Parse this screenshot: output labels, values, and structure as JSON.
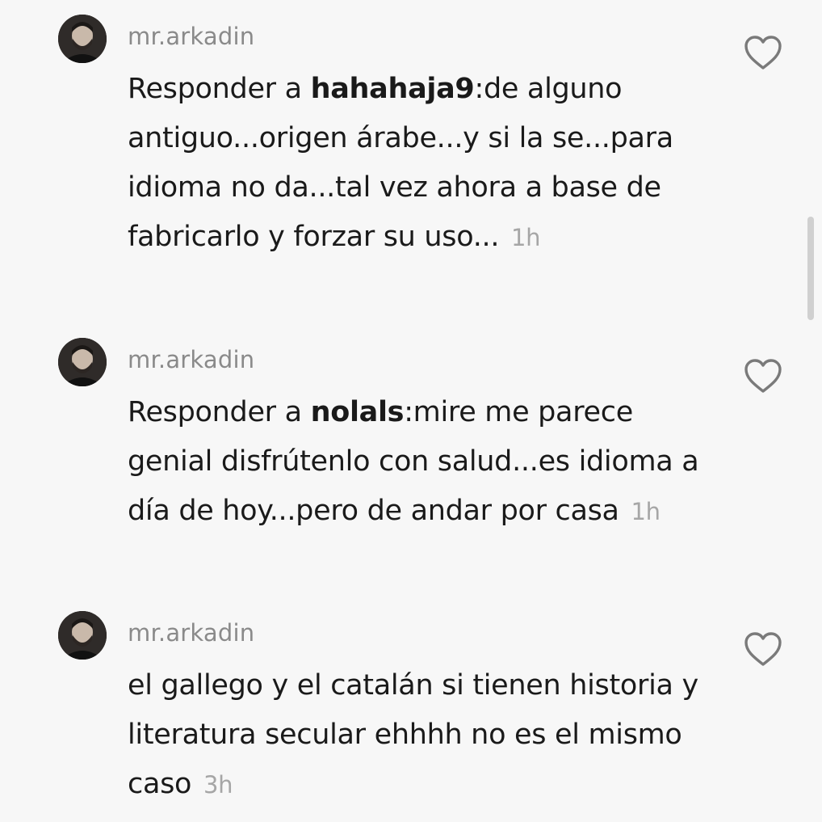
{
  "comments": [
    {
      "username": "mr.arkadin",
      "reply_prefix": "Responder a ",
      "reply_to": "hahahaja9",
      "text": ":de alguno antiguo...origen árabe...y si la se...para idioma no da...tal vez ahora a base de fabricarlo y forzar su uso...",
      "time": "1h"
    },
    {
      "username": "mr.arkadin",
      "reply_prefix": "Responder a ",
      "reply_to": "nolals",
      "text": ":mire me parece genial disfrútenlo con salud...es idioma a día de hoy...pero de andar por casa",
      "time": "1h"
    },
    {
      "username": "mr.arkadin",
      "text": "el gallego y el catalán si tienen historia y literatura secular ehhhh no es el mismo caso",
      "time": "3h"
    }
  ],
  "icons": {
    "like": "heart-outline-icon",
    "avatar": "avatar"
  },
  "colors": {
    "background": "#f7f7f7",
    "username": "#8a8a8a",
    "text": "#1a1a1a",
    "timestamp": "#a6a6a6",
    "icon": "#7a7a7a"
  }
}
